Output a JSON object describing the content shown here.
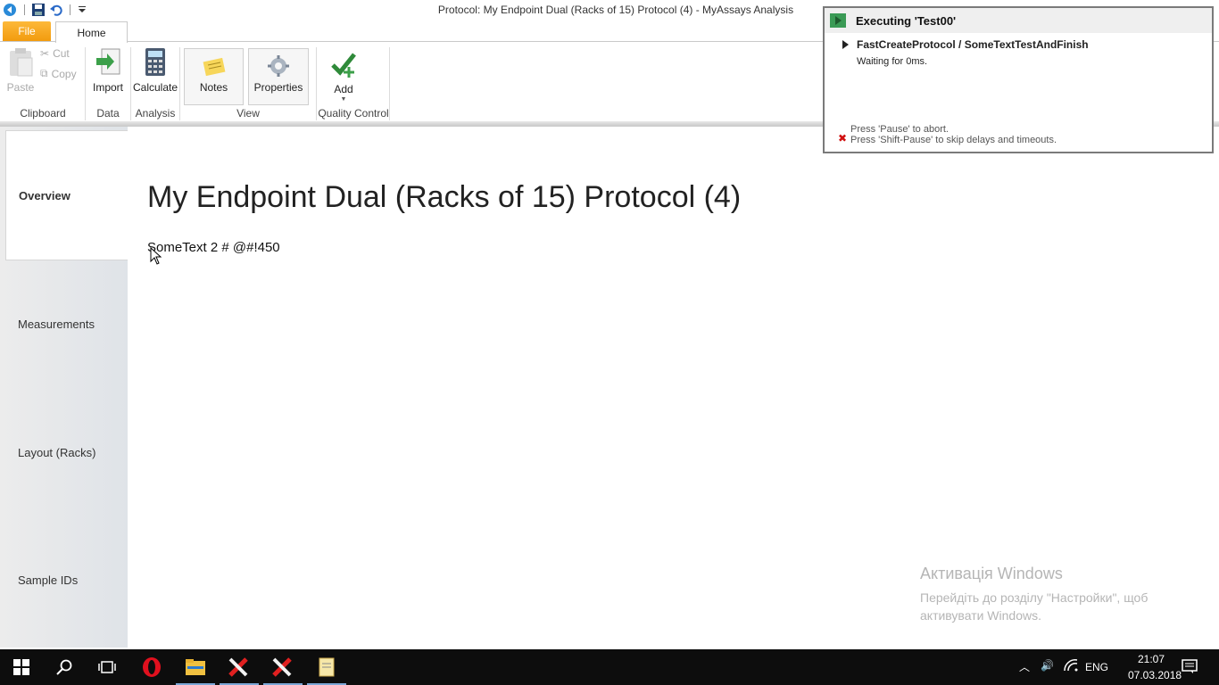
{
  "window": {
    "title": "Protocol: My Endpoint Dual (Racks of 15) Protocol (4) - MyAssays Analysis"
  },
  "quick_access": [
    "back-icon",
    "save-icon",
    "undo-icon",
    "customize-icon"
  ],
  "ribbon": {
    "tabs": {
      "file": "File",
      "home": "Home"
    },
    "clipboard": {
      "paste": "Paste",
      "cut": "Cut",
      "copy": "Copy",
      "group": "Clipboard"
    },
    "data": {
      "import": "Import",
      "group": "Data"
    },
    "analysis": {
      "calculate": "Calculate",
      "group": "Analysis"
    },
    "view": {
      "notes": "Notes",
      "properties": "Properties",
      "group": "View"
    },
    "quality_control": {
      "add": "Add",
      "group": "Quality Control"
    }
  },
  "nav": {
    "items": [
      {
        "label": "Overview"
      },
      {
        "label": "Measurements"
      },
      {
        "label": "Layout (Racks)"
      },
      {
        "label": "Sample IDs"
      }
    ]
  },
  "content": {
    "title": "My Endpoint Dual (Racks of 15) Protocol (4)",
    "text": "SomeText 2 # @#!450"
  },
  "executing": {
    "title": "Executing 'Test00'",
    "step": "FastCreateProtocol / SomeTextTestAndFinish",
    "status": "Waiting for 0ms.",
    "hint_pause": "Press 'Pause' to abort.",
    "hint_shift_pause": "Press 'Shift-Pause' to skip delays and timeouts."
  },
  "watermark": {
    "title": "Активація Windows",
    "line1": "Перейдіть до розділу \"Настройки\", щоб",
    "line2": "активувати Windows."
  },
  "taskbar": {
    "language": "ENG",
    "time": "21:07",
    "date": "07.03.2018"
  },
  "colors": {
    "file_tab": "#f29b0e",
    "exec_icon": "#3a9a55",
    "taskbar": "#0d0d0d"
  }
}
